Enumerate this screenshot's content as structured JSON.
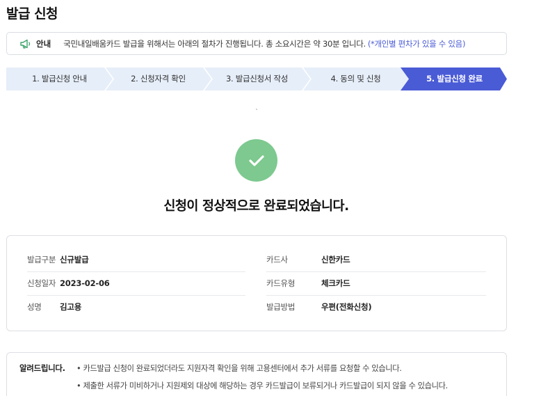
{
  "page": {
    "title": "발급 신청"
  },
  "notice": {
    "icon": "megaphone-icon",
    "label": "안내",
    "text": "국민내일배움카드 발급을 위해서는 아래의 절차가 진행됩니다. 총 소요시간은 약 30분 입니다.",
    "highlight": "(*개인별 편차가 있을 수 있음)",
    "highlight_color": "#4a5bd6"
  },
  "steps": [
    {
      "label": "1. 발급신청 안내",
      "active": false
    },
    {
      "label": "2. 신청자격 확인",
      "active": false
    },
    {
      "label": "3. 발급신청서 작성",
      "active": false
    },
    {
      "label": "4. 동의 및 신청",
      "active": false
    },
    {
      "label": "5. 발급신청 완료",
      "active": true
    }
  ],
  "colors": {
    "step_inactive": "#e6eef9",
    "step_active": "#4a5bd6",
    "success": "#7dc98f"
  },
  "tick_mark": "`",
  "success": {
    "icon": "check-icon",
    "message": "신청이 정상적으로 완료되었습니다."
  },
  "details": {
    "left": [
      {
        "key": "발급구분",
        "value": "신규발급"
      },
      {
        "key": "신청일자",
        "value": "2023-02-06"
      },
      {
        "key": "성명",
        "value": "김고용"
      }
    ],
    "right": [
      {
        "key": "카드사",
        "value": "신한카드"
      },
      {
        "key": "카드유형",
        "value": "체크카드"
      },
      {
        "key": "발급방법",
        "value": "우편(전화신청)"
      }
    ]
  },
  "alert": {
    "title": "알려드립니다.",
    "items": [
      "• 카드발급 신청이 완료되었더라도 지원자격 확인을 위해 고용센터에서 추가 서류를 요청할 수 있습니다.",
      "• 제출한 서류가 미비하거나 지원제외 대상에 해당하는 경우 카드발급이 보류되거나 카드발급이 되지 않을 수 있습니다."
    ]
  }
}
